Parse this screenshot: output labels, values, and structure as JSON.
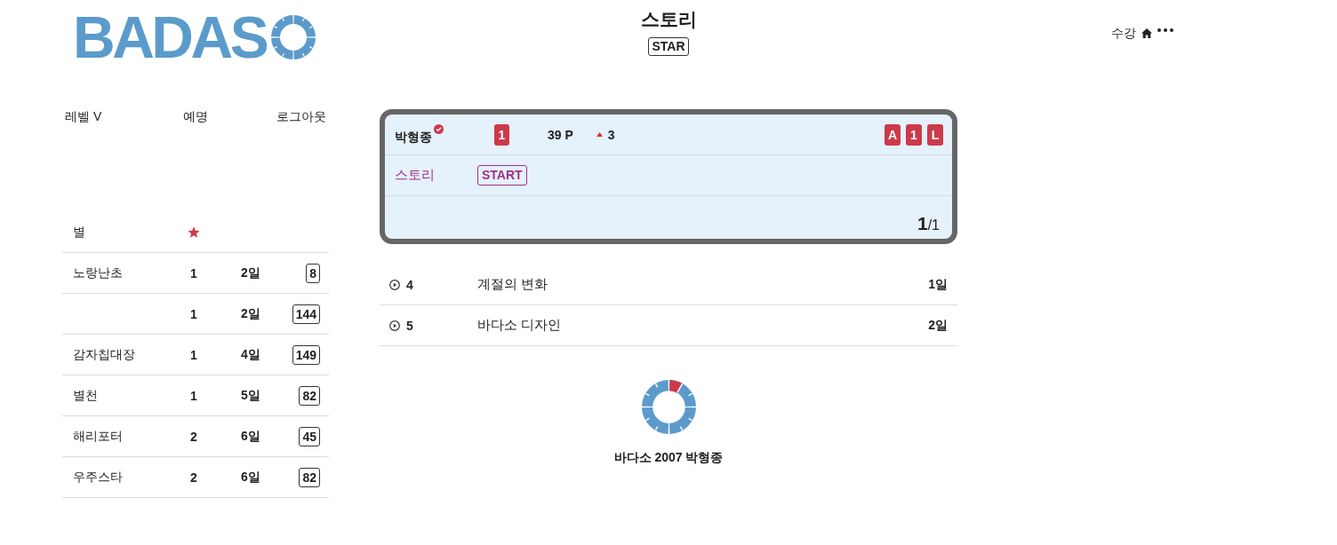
{
  "header": {
    "logo": {
      "text": "BADAS"
    },
    "title": "스토리",
    "badge": "STAR",
    "menu": {
      "label": "수강"
    }
  },
  "sidebar": {
    "nav": [
      {
        "label": "레벨 V"
      },
      {
        "label": "예명"
      },
      {
        "label": "로그아웃"
      }
    ],
    "table": {
      "header": "별",
      "rows": [
        {
          "name": "노랑난초",
          "count": "1",
          "days": "2일",
          "score": "8"
        },
        {
          "count": "1",
          "days": "2일",
          "score": "144"
        },
        {
          "name": "감자칩대장",
          "count": "1",
          "days": "4일",
          "score": "149"
        },
        {
          "name": "별천",
          "count": "1",
          "days": "5일",
          "score": "82"
        },
        {
          "name": "해리포터",
          "count": "2",
          "days": "6일",
          "score": "45"
        },
        {
          "name": "우주스타",
          "count": "2",
          "days": "6일",
          "score": "82"
        }
      ]
    }
  },
  "card": {
    "user": {
      "name": "박형종",
      "verified": true
    },
    "rank": "1",
    "points": "39 P",
    "trend": {
      "rising": true,
      "value": "3"
    },
    "tags": [
      "A",
      "1",
      "L"
    ],
    "story": {
      "label": "스토리",
      "status": "START"
    },
    "pager": {
      "current": "1",
      "rest": "/1"
    }
  },
  "episodes": [
    {
      "number": "4",
      "title": "계절의 변화",
      "days": "1일"
    },
    {
      "number": "5",
      "title": "바다소 디자인",
      "days": "2일"
    }
  ],
  "footer": {
    "caption": "바다소 2007 박형종"
  }
}
